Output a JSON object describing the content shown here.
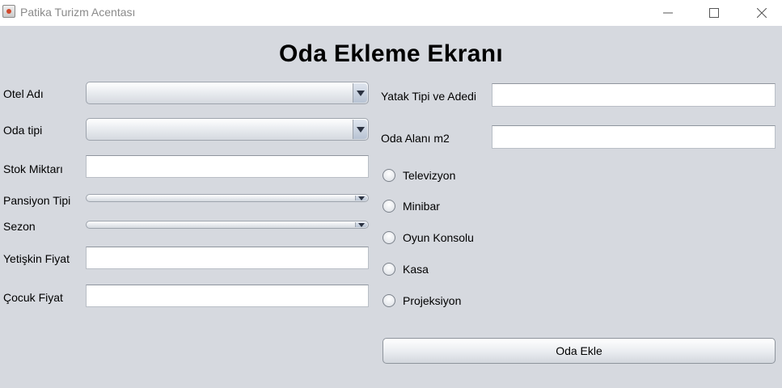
{
  "window": {
    "title": "Patika Turizm Acentası"
  },
  "heading": "Oda Ekleme Ekranı",
  "left_form": {
    "otel_adi": {
      "label": "Otel Adı",
      "value": ""
    },
    "oda_tipi": {
      "label": "Oda tipi",
      "value": ""
    },
    "stok_miktari": {
      "label": "Stok Miktarı",
      "value": ""
    },
    "pansiyon_tipi": {
      "label": "Pansiyon Tipi",
      "value": ""
    },
    "sezon": {
      "label": "Sezon",
      "value": ""
    },
    "yetiskin_fiyat": {
      "label": "Yetişkin Fiyat",
      "value": ""
    },
    "cocuk_fiyat": {
      "label": "Çocuk Fiyat",
      "value": ""
    }
  },
  "right_form": {
    "yatak_tipi": {
      "label": "Yatak Tipi ve Adedi",
      "value": ""
    },
    "oda_alani": {
      "label": "Oda Alanı m2",
      "value": ""
    }
  },
  "features": [
    {
      "label": "Televizyon",
      "checked": false
    },
    {
      "label": "Minibar",
      "checked": false
    },
    {
      "label": "Oyun Konsolu",
      "checked": false
    },
    {
      "label": "Kasa",
      "checked": false
    },
    {
      "label": "Projeksiyon",
      "checked": false
    }
  ],
  "submit_label": "Oda Ekle",
  "icons": {
    "app": "java-cup-icon",
    "minimize": "minimize-icon",
    "maximize": "maximize-icon",
    "close": "close-icon"
  }
}
